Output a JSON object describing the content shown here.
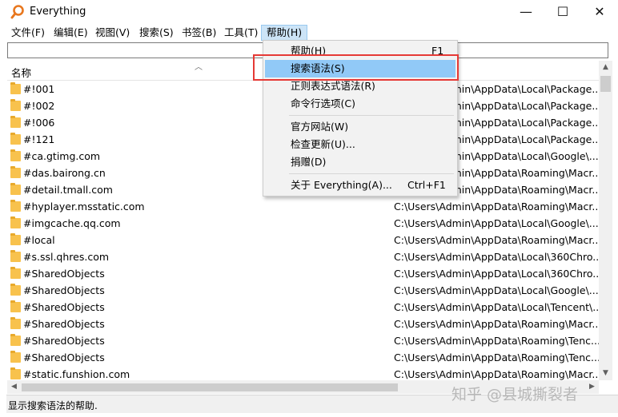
{
  "window": {
    "title": "Everything",
    "controls": {
      "minimize": "—",
      "maximize": "☐",
      "close": "✕"
    }
  },
  "menubar": [
    {
      "label": "文件(F)"
    },
    {
      "label": "编辑(E)"
    },
    {
      "label": "视图(V)"
    },
    {
      "label": "搜索(S)"
    },
    {
      "label": "书签(B)"
    },
    {
      "label": "工具(T)"
    },
    {
      "label": "帮助(H)",
      "active": true
    }
  ],
  "search": {
    "value": ""
  },
  "list": {
    "header": {
      "name": "名称",
      "sort_icon": "sort-ascending-icon"
    },
    "rows": [
      {
        "name": "#!001",
        "path": "C:\\Users\\Admin\\AppData\\Local\\Package..."
      },
      {
        "name": "#!002",
        "path": "C:\\Users\\Admin\\AppData\\Local\\Package..."
      },
      {
        "name": "#!006",
        "path": "C:\\Users\\Admin\\AppData\\Local\\Package..."
      },
      {
        "name": "#!121",
        "path": "C:\\Users\\Admin\\AppData\\Local\\Package..."
      },
      {
        "name": "#ca.gtimg.com",
        "path": "C:\\Users\\Admin\\AppData\\Local\\Google\\..."
      },
      {
        "name": "#das.bairong.cn",
        "path": "C:\\Users\\Admin\\AppData\\Roaming\\Macr..."
      },
      {
        "name": "#detail.tmall.com",
        "path": "C:\\Users\\Admin\\AppData\\Roaming\\Macr..."
      },
      {
        "name": "#hyplayer.msstatic.com",
        "path": "C:\\Users\\Admin\\AppData\\Roaming\\Macr..."
      },
      {
        "name": "#imgcache.qq.com",
        "path": "C:\\Users\\Admin\\AppData\\Local\\Google\\..."
      },
      {
        "name": "#local",
        "path": "C:\\Users\\Admin\\AppData\\Roaming\\Macr..."
      },
      {
        "name": "#s.ssl.qhres.com",
        "path": "C:\\Users\\Admin\\AppData\\Local\\360Chro..."
      },
      {
        "name": "#SharedObjects",
        "path": "C:\\Users\\Admin\\AppData\\Local\\360Chro..."
      },
      {
        "name": "#SharedObjects",
        "path": "C:\\Users\\Admin\\AppData\\Local\\Google\\..."
      },
      {
        "name": "#SharedObjects",
        "path": "C:\\Users\\Admin\\AppData\\Local\\Tencent\\..."
      },
      {
        "name": "#SharedObjects",
        "path": "C:\\Users\\Admin\\AppData\\Roaming\\Macr..."
      },
      {
        "name": "#SharedObjects",
        "path": "C:\\Users\\Admin\\AppData\\Roaming\\Tenc..."
      },
      {
        "name": "#SharedObjects",
        "path": "C:\\Users\\Admin\\AppData\\Roaming\\Tenc..."
      },
      {
        "name": "#static.funshion.com",
        "path": "C:\\Users\\Admin\\AppData\\Roaming\\Macr..."
      }
    ]
  },
  "help_menu": {
    "items": [
      {
        "label": "帮助(H)",
        "shortcut": "F1"
      },
      {
        "label": "搜索语法(S)",
        "shortcut": "",
        "highlighted": true
      },
      {
        "label": "正则表达式语法(R)",
        "shortcut": ""
      },
      {
        "label": "命令行选项(C)",
        "shortcut": ""
      },
      {
        "label": "官方网站(W)",
        "shortcut": ""
      },
      {
        "label": "检查更新(U)...",
        "shortcut": ""
      },
      {
        "label": "捐赠(D)",
        "shortcut": ""
      },
      {
        "label": "关于 Everything(A)...",
        "shortcut": "Ctrl+F1"
      }
    ]
  },
  "status": {
    "text": "显示搜索语法的帮助."
  },
  "watermark": "知乎 @县城撕裂者",
  "colors": {
    "folder": "#f8c24d",
    "menu_highlight": "#91c9f7",
    "annotation_box": "#e53935",
    "app_icon": "#e8771e"
  }
}
